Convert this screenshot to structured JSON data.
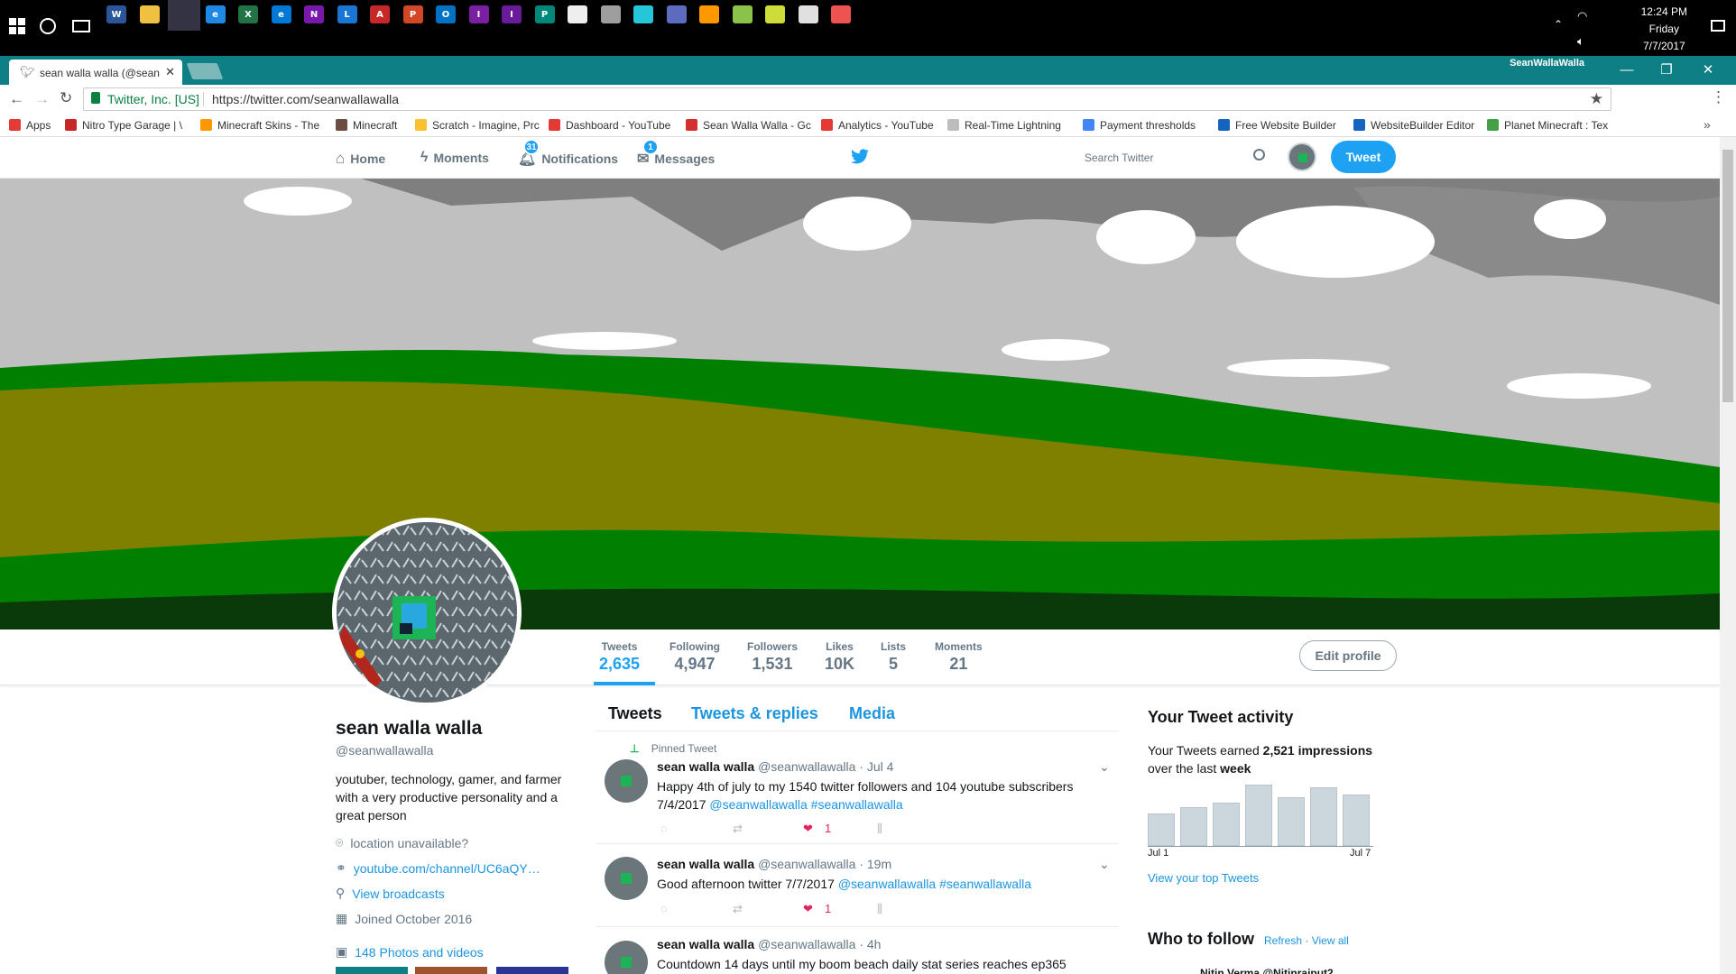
{
  "taskbar": {
    "icons": [
      {
        "label": "W",
        "color": "#2b579a",
        "icon": "word-icon"
      },
      {
        "label": "",
        "color": "#f0c040",
        "icon": "file-explorer-icon"
      },
      {
        "label": "",
        "color": "#4caf50",
        "icon": "chrome-icon"
      },
      {
        "label": "e",
        "color": "#1e88e5",
        "icon": "internet-explorer-icon"
      },
      {
        "label": "X",
        "color": "#217346",
        "icon": "excel-icon"
      },
      {
        "label": "e",
        "color": "#0078d7",
        "icon": "edge-icon"
      },
      {
        "label": "N",
        "color": "#7719aa",
        "icon": "onenote-icon"
      },
      {
        "label": "L",
        "color": "#1976d2",
        "icon": "lync-icon"
      },
      {
        "label": "A",
        "color": "#c62828",
        "icon": "access-icon"
      },
      {
        "label": "P",
        "color": "#d24726",
        "icon": "powerpoint-icon"
      },
      {
        "label": "O",
        "color": "#0072c6",
        "icon": "outlook-icon"
      },
      {
        "label": "I",
        "color": "#7b1fa2",
        "icon": "infopath-icon"
      },
      {
        "label": "I",
        "color": "#6a1b9a",
        "icon": "infopath-filler-icon"
      },
      {
        "label": "P",
        "color": "#00897b",
        "icon": "publisher-icon"
      },
      {
        "label": "",
        "color": "#eeeeee",
        "icon": "calculator-icon"
      },
      {
        "label": "",
        "color": "#9e9e9e",
        "icon": "minecraft-icon"
      },
      {
        "label": "",
        "color": "#26c6da",
        "icon": "diamond-icon"
      },
      {
        "label": "",
        "color": "#5c6bc0",
        "icon": "globe-icon"
      },
      {
        "label": "",
        "color": "#ff9800",
        "icon": "vlc-icon"
      },
      {
        "label": "",
        "color": "#8bc34a",
        "icon": "game-icon"
      },
      {
        "label": "",
        "color": "#cddc39",
        "icon": "flash-icon"
      },
      {
        "label": "",
        "color": "#e0e0e0",
        "icon": "notes-icon"
      },
      {
        "label": "",
        "color": "#ef5350",
        "icon": "chrome-canary-icon"
      }
    ],
    "clock": {
      "time": "12:24 PM",
      "day": "Friday",
      "date": "7/7/2017"
    }
  },
  "browser": {
    "tab_title": "sean walla walla (@sean",
    "profile_name": "SeanWallaWalla",
    "secure_label": "Twitter, Inc. [US]",
    "url": "https://twitter.com/seanwallawalla",
    "bookmarks": [
      {
        "label": "Apps",
        "color": "#e53935"
      },
      {
        "label": "Nitro Type Garage | \\",
        "color": "#c62828"
      },
      {
        "label": "Minecraft Skins - The",
        "color": "#ff9800"
      },
      {
        "label": "Minecraft",
        "color": "#6d4c41"
      },
      {
        "label": "Scratch - Imagine, Prc",
        "color": "#fbc02d"
      },
      {
        "label": "Dashboard - YouTube",
        "color": "#e53935"
      },
      {
        "label": "Sean Walla Walla - Gc",
        "color": "#d32f2f"
      },
      {
        "label": "Analytics - YouTube",
        "color": "#e53935"
      },
      {
        "label": "Real-Time Lightning",
        "color": "#bdbdbd"
      },
      {
        "label": "Payment thresholds",
        "color": "#4285f4"
      },
      {
        "label": "Free Website Builder",
        "color": "#1565c0"
      },
      {
        "label": "WebsiteBuilder Editor",
        "color": "#1565c0"
      },
      {
        "label": "Planet Minecraft : Tex",
        "color": "#43a047"
      }
    ]
  },
  "twitter_nav": {
    "home": "Home",
    "moments": "Moments",
    "notifications": "Notifications",
    "notifications_count": "31",
    "messages": "Messages",
    "messages_count": "1",
    "search_placeholder": "Search Twitter",
    "tweet_button": "Tweet"
  },
  "profile": {
    "name": "sean walla walla",
    "handle": "@seanwallawalla",
    "bio": "youtuber, technology, gamer, and farmer with a very productive personality and a great person",
    "location": "location unavailable?",
    "website": "youtube.com/channel/UC6aQY…",
    "broadcasts": "View broadcasts",
    "joined": "Joined October 2016",
    "photos": "148 Photos and videos",
    "edit_profile": "Edit profile"
  },
  "stats": [
    {
      "label": "Tweets",
      "value": "2,635"
    },
    {
      "label": "Following",
      "value": "4,947"
    },
    {
      "label": "Followers",
      "value": "1,531"
    },
    {
      "label": "Likes",
      "value": "10K"
    },
    {
      "label": "Lists",
      "value": "5"
    },
    {
      "label": "Moments",
      "value": "21"
    }
  ],
  "timeline_tabs": [
    "Tweets",
    "Tweets & replies",
    "Media"
  ],
  "tweets": [
    {
      "pinned_label": "Pinned Tweet",
      "name": "sean walla walla",
      "handle_time": "@seanwallawalla · Jul 4",
      "text": "Happy 4th of july to my 1540 twitter followers and 104 youtube subscribers 7/4/2017",
      "links": "@seanwallawalla #seanwallawalla",
      "likes": "1"
    },
    {
      "name": "sean walla walla",
      "handle_time": "@seanwallawalla · 19m",
      "text": "Good afternoon twitter 7/7/2017",
      "links": "@seanwallawalla #seanwallawalla",
      "likes": "1"
    },
    {
      "name": "sean walla walla",
      "handle_time": "@seanwallawalla · 4h",
      "text": "Countdown 14 days until my boom beach daily stat series reaches ep365",
      "links": ""
    }
  ],
  "activity": {
    "title": "Your Tweet activity",
    "line1": "Your Tweets earned",
    "impressions": "2,521 impressions",
    "line2": "over the last",
    "period": "week",
    "start_label": "Jul 1",
    "end_label": "Jul 7",
    "top_tweets_link": "View your top Tweets"
  },
  "chart_data": {
    "type": "bar",
    "categories": [
      "Jul 1",
      "Jul 2",
      "Jul 3",
      "Jul 4",
      "Jul 5",
      "Jul 6",
      "Jul 7"
    ],
    "values": [
      38,
      45,
      50,
      72,
      57,
      68,
      60
    ],
    "ylim": [
      0,
      80
    ],
    "grid": false
  },
  "who_to_follow": {
    "title": "Who to follow",
    "refresh": "Refresh",
    "view_all": "View all",
    "first_user": "Nitin Verma @Nitinrajput2"
  }
}
